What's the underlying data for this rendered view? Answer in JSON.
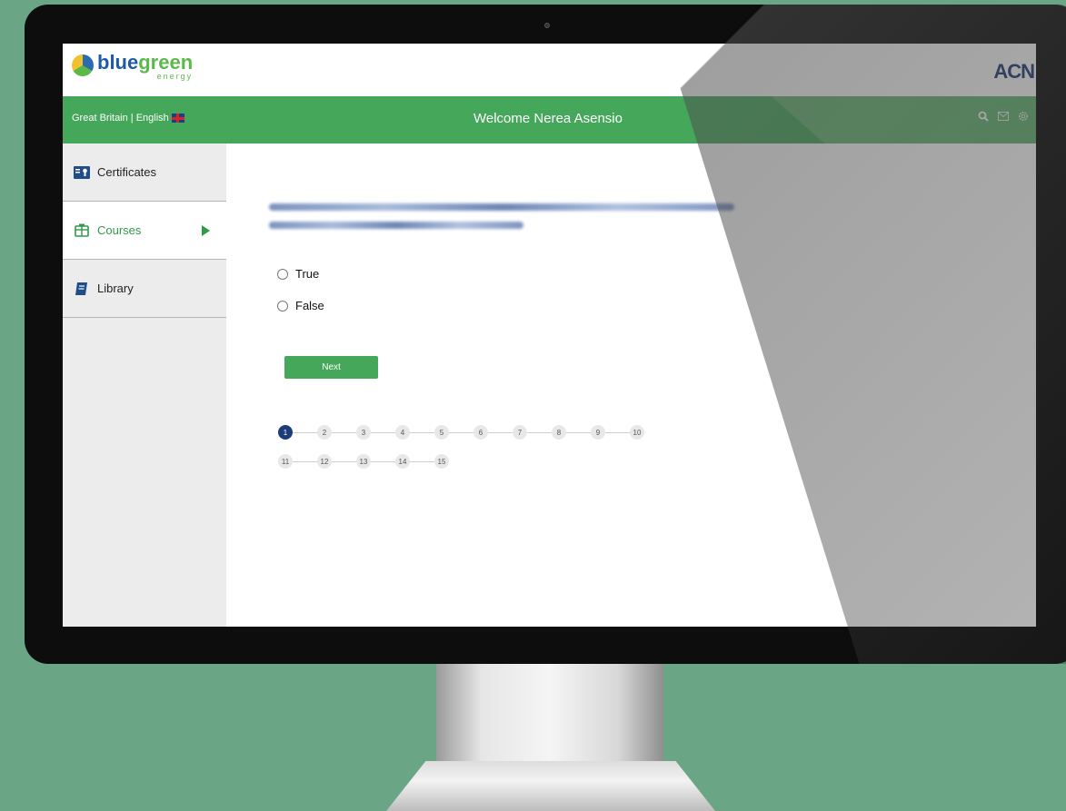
{
  "brand": {
    "logo_part1": "blue",
    "logo_part2": "green",
    "logo_sub": "energy",
    "partner": "ACN"
  },
  "topbar": {
    "locale": "Great Britain | English",
    "welcome": "Welcome Nerea Asensio",
    "icons": [
      "search-icon",
      "mail-icon",
      "settings-icon"
    ]
  },
  "sidebar": {
    "items": [
      {
        "label": "Certificates",
        "icon": "certificate-icon",
        "active": false
      },
      {
        "label": "Courses",
        "icon": "courses-icon",
        "active": true
      },
      {
        "label": "Library",
        "icon": "book-icon",
        "active": false
      }
    ]
  },
  "quiz": {
    "options": [
      "True",
      "False"
    ],
    "next_label": "Next",
    "current_step": 1,
    "steps_row1": [
      "1",
      "2",
      "3",
      "4",
      "5",
      "6",
      "7",
      "8",
      "9",
      "10"
    ],
    "steps_row2": [
      "11",
      "12",
      "13",
      "14",
      "15"
    ]
  },
  "colors": {
    "accent": "#44a75a",
    "brand_blue": "#1e5aa8",
    "step_current": "#1c3d78"
  }
}
